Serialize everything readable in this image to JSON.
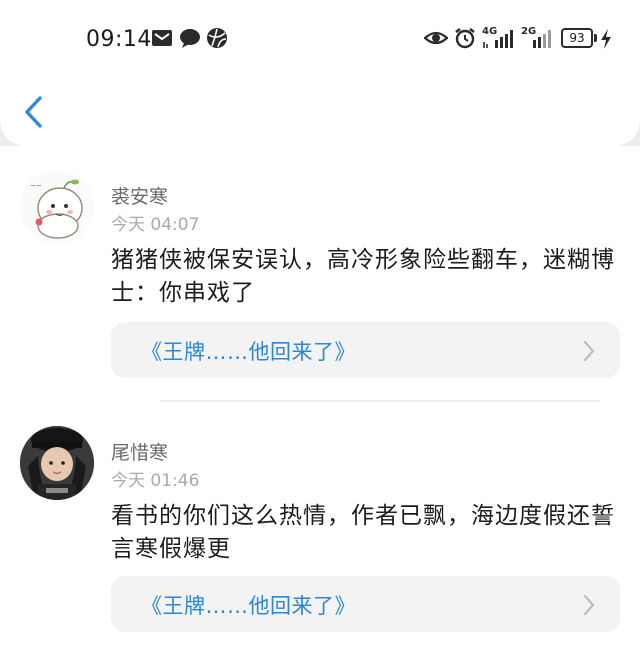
{
  "status_bar": {
    "time": "09:14",
    "net_primary": "4G",
    "net_secondary": "2G",
    "battery": "93"
  },
  "nav": {
    "back_icon": "back-arrow-icon"
  },
  "comments": [
    {
      "user": "裘安寒",
      "time": "今天 04:07",
      "text": "猪猪侠被保安误认，高冷形象险些翻车，迷糊博士：你串戏了",
      "book": "《王牌……他回来了》"
    },
    {
      "user": "尾惜寒",
      "time": "今天 01:46",
      "text": "看书的你们这么热情，作者已飘，海边度假还誓言寒假爆更",
      "book": "《王牌……他回来了》"
    }
  ],
  "colors": {
    "link": "#2a86d8",
    "accent": "#2a8cd8"
  }
}
